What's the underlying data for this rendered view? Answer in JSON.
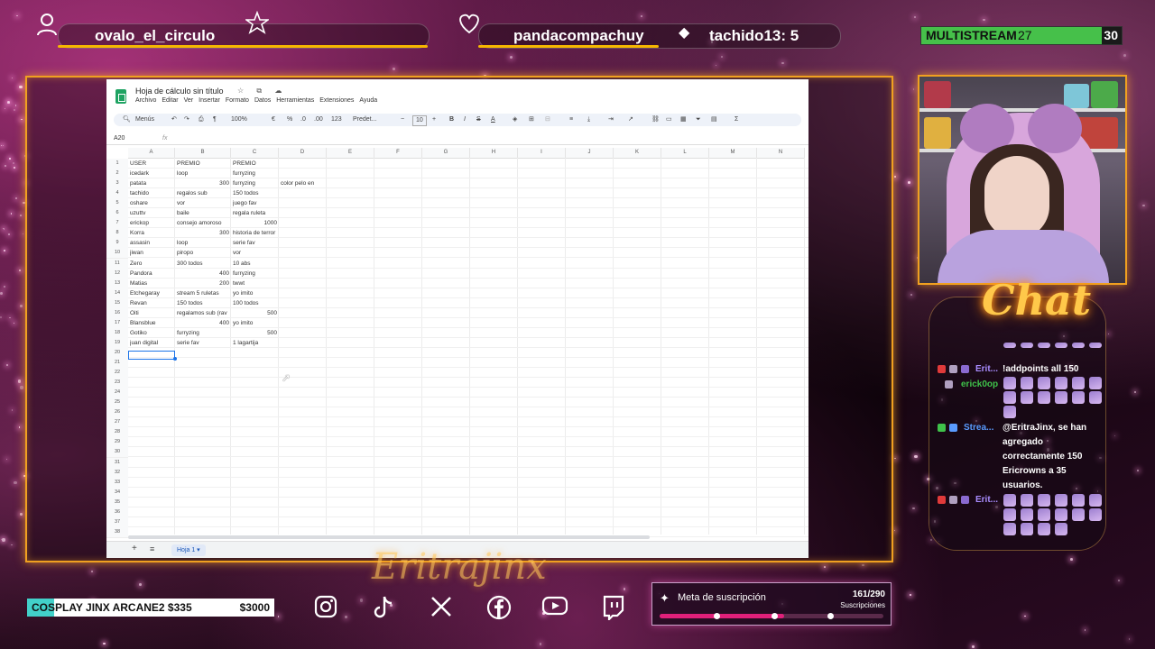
{
  "top": {
    "user_left": "ovalo_el_circulo",
    "user_mid": "pandacompachuy",
    "user_right": "tachido13: 5",
    "multistream_label": "MULTISTREAM",
    "multistream_count": "27",
    "multistream_goal": "30",
    "multistream_progress": 0.9,
    "icons": [
      "user-icon",
      "star-icon",
      "heart-icon",
      "diamond-icon"
    ]
  },
  "sheet": {
    "title": "Hoja de cálculo sin título",
    "title_icons": "☆ ⧉ ☁",
    "menu": [
      "Archivo",
      "Editar",
      "Ver",
      "Insertar",
      "Formato",
      "Datos",
      "Herramientas",
      "Extensiones",
      "Ayuda"
    ],
    "toolbar": {
      "menus": "Menús",
      "zoom": "100%",
      "currency": "€",
      "percent": "%",
      "dec_less": ".0",
      "dec_more": ".00",
      "format_123": "123",
      "font": "Predet...",
      "font_size": "10",
      "minus": "−",
      "plus": "+"
    },
    "cell_ref": "A20",
    "fx": "fx",
    "columns": [
      "A",
      "B",
      "C",
      "D",
      "E",
      "F",
      "G",
      "H",
      "I",
      "J",
      "K",
      "L",
      "M",
      "N"
    ],
    "rows": [
      [
        "USER",
        "PREMIO",
        "PREMIO",
        ""
      ],
      [
        "icedark",
        "loop",
        "furryzing",
        ""
      ],
      [
        "patata",
        "300",
        "furryzing",
        "color pelo en"
      ],
      [
        "tachido",
        "regalos sub",
        "150 todos",
        ""
      ],
      [
        "oshare",
        "vor",
        "juego fav",
        ""
      ],
      [
        "uzuttv",
        "baile",
        "regala ruleta",
        ""
      ],
      [
        "erickop",
        "consejo amoroso",
        "1000",
        ""
      ],
      [
        "Korra",
        "300",
        "historia de terror",
        ""
      ],
      [
        "assasin",
        "loop",
        "serie fav",
        ""
      ],
      [
        "jiwan",
        "piropo",
        "vor",
        ""
      ],
      [
        "Zero",
        "300 todos",
        "10 abs",
        ""
      ],
      [
        "Pandora",
        "400",
        "furryzing",
        ""
      ],
      [
        "Matias",
        "200",
        "twwt",
        ""
      ],
      [
        "Etchegaray",
        "stream 5 ruletas",
        "yo imito",
        ""
      ],
      [
        "Revan",
        "150 todos",
        "100 todos",
        ""
      ],
      [
        "Oiti",
        "regalamos sub (rav",
        "500",
        ""
      ],
      [
        "Blansblue",
        "400",
        "yo imito",
        ""
      ],
      [
        "Gotiko",
        "furryzing",
        "500",
        ""
      ],
      [
        "juan digital",
        "serie fav",
        "1 lagartija",
        ""
      ]
    ],
    "numeric_cells": {
      "2_1": true,
      "6_2": true,
      "7_1": true,
      "11_1": true,
      "12_1": true,
      "15_2": true,
      "16_1": true,
      "17_2": true
    },
    "row_numbers": [
      "1",
      "2",
      "3",
      "4",
      "5",
      "6",
      "7",
      "8",
      "9",
      "10",
      "11",
      "12",
      "13",
      "14",
      "15",
      "16",
      "17",
      "18",
      "19",
      "20",
      "21",
      "22",
      "23",
      "24",
      "25",
      "26",
      "27",
      "28",
      "29",
      "30",
      "31",
      "32",
      "33",
      "34",
      "35",
      "36",
      "37",
      "38"
    ],
    "sheet_tab": "Hoja 1 ▾",
    "add_sheet": "+",
    "sheet_list": "≡"
  },
  "chat": {
    "title": "Chat",
    "messages": [
      {
        "user": "Erit...",
        "text": "!addpoints all 150",
        "user_color": "#a98cff"
      },
      {
        "user": "erick0op",
        "text": "",
        "user_color": "#3fc24a"
      },
      {
        "user": "Strea...",
        "text": "@EritraJinx, se han agregado correctamente 150 Ericrowns a 35 usuarios.",
        "user_color": "#5a9cff"
      },
      {
        "user": "Erit...",
        "text": "",
        "user_color": "#a98cff"
      }
    ]
  },
  "bottom": {
    "goal_label": "COSPLAY JINX ARCANE2 $335",
    "goal_amount": "$3000",
    "goal_progress": 0.11,
    "socials": [
      "instagram-icon",
      "tiktok-icon",
      "x-icon",
      "facebook-icon",
      "youtube-icon",
      "twitch-icon"
    ],
    "sub_goal_label": "Meta de suscripción",
    "sub_goal_count": "161/290",
    "sub_goal_unit": "Suscripciones",
    "sub_goal_progress": 0.555
  },
  "colors": {
    "accent": "#f0a020",
    "multistream": "#46c04a",
    "cosplay": "#42d0c9",
    "sub_bar": "#e0207a"
  }
}
